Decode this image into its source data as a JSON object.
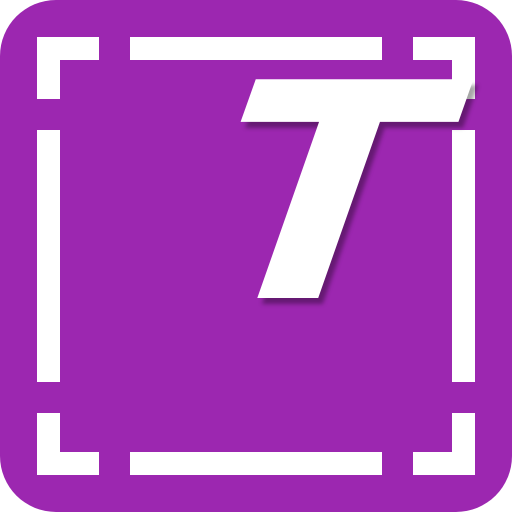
{
  "icon": {
    "glyph": "T",
    "semantic": "text-tool-icon",
    "colors": {
      "background": "#9C27B0",
      "foreground": "#FFFFFF",
      "shadow": "rgba(0,0,0,0.35)"
    }
  }
}
